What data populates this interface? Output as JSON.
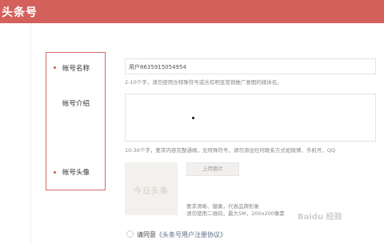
{
  "header": {
    "brand": "头条号"
  },
  "form": {
    "name": {
      "label": "帐号名称",
      "value": "用户8635915054954",
      "hint": "2-10个字，请勿使用含特殊符号或含有明显营销推广意图的媒体名。"
    },
    "intro": {
      "label": "帐号介绍",
      "value": "",
      "hint": "10-30个字，要求内容完整通顺，无特殊符号，请勿添加任何联系方式如微博、手机号、QQ"
    },
    "avatar": {
      "label": "帐号头像",
      "placeholder_text": "今日头条",
      "upload_label": "上传图片",
      "hint_line1": "要求清晰、健康，代表品牌形象",
      "hint_line2": "请勿使用二维码，最大5M，200x200像素"
    },
    "agreement": {
      "prefix": "请同意",
      "link": "《头条号用户注册协议》"
    }
  },
  "watermark": "Baidu 经验"
}
